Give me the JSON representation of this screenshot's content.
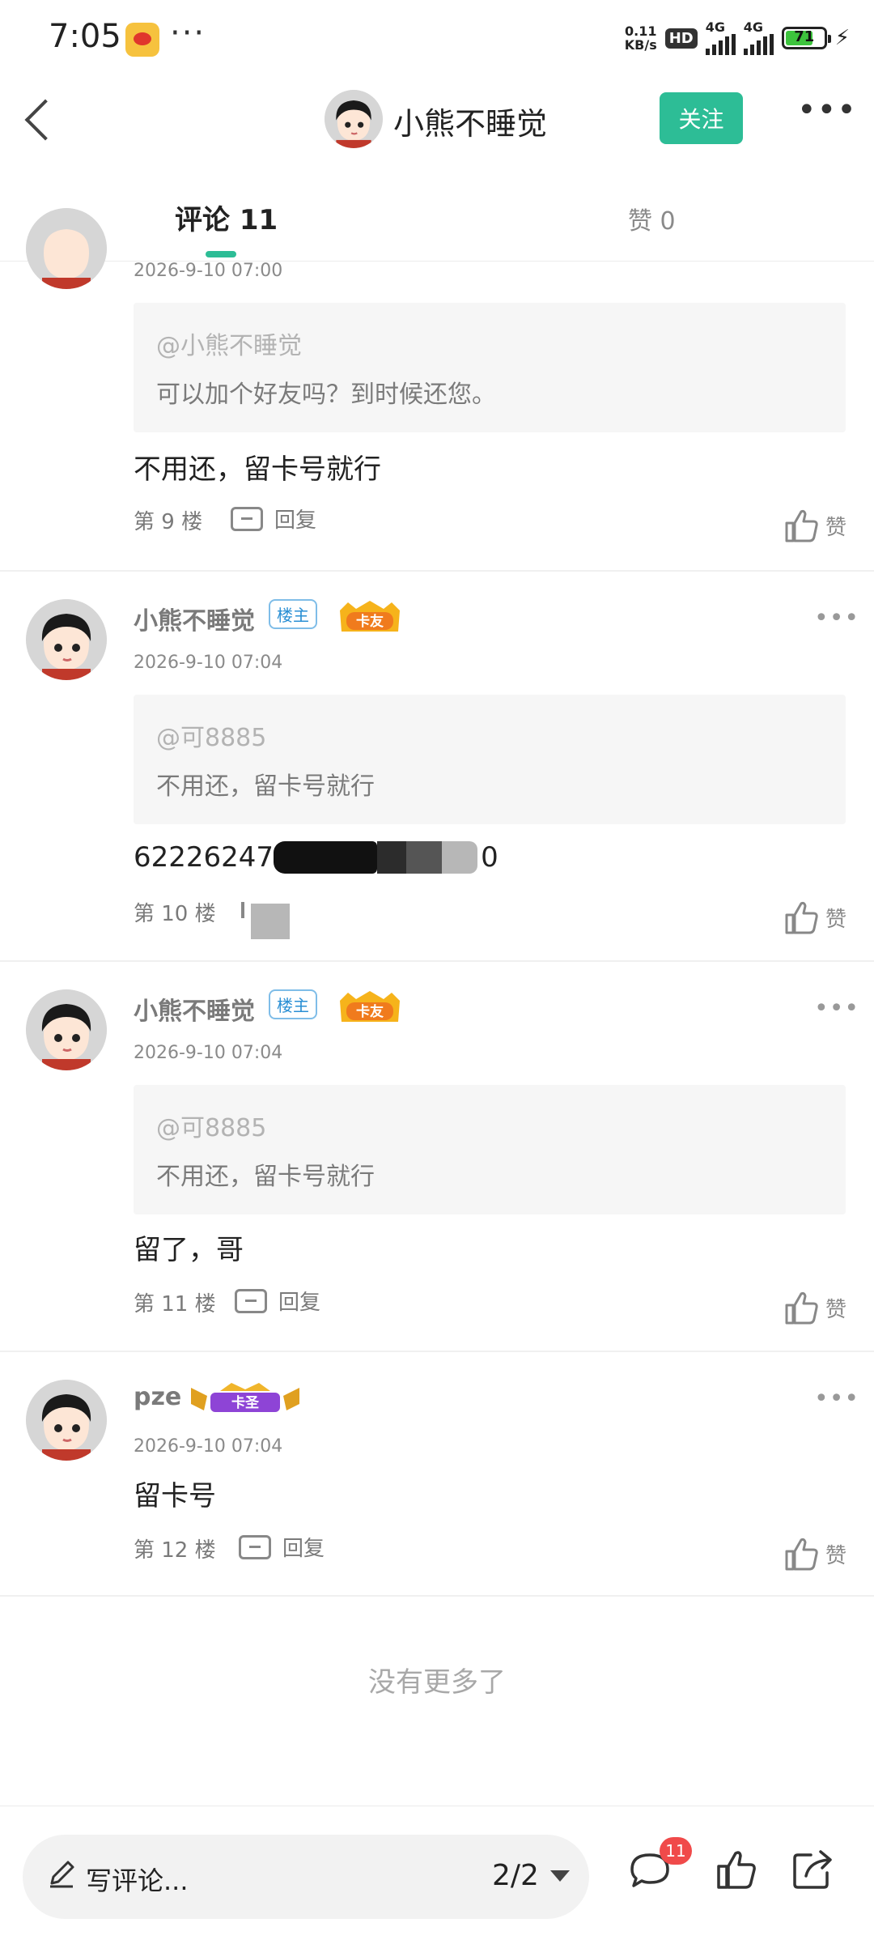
{
  "status_bar": {
    "time": "7:05",
    "app_icon": "weibo-icon",
    "more_dots": "···",
    "net_speed_top": "0.11",
    "net_speed_bottom": "KB/s",
    "hd_label": "HD",
    "signal1_label": "4G",
    "signal2_label": "4G",
    "battery_level": "71",
    "battery_fraction": 0.71
  },
  "header": {
    "username": "小熊不睡觉",
    "follow_label": "关注",
    "more_label": "•••"
  },
  "tabs": [
    {
      "label": "评论 11",
      "active": true
    },
    {
      "label": "赞 0",
      "active": false
    }
  ],
  "comments": [
    {
      "partial": true,
      "time": "2026-9-10 07:00",
      "quote_at": "@小熊不睡觉",
      "quote_text": "可以加个好友吗？到时候还您。",
      "text": "不用还，留卡号就行",
      "floor": "第 9 楼",
      "reply_label": "回复",
      "like_label": "赞"
    },
    {
      "name": "小熊不睡觉",
      "host_badge": "楼主",
      "level_badge": "卡友",
      "time": "2026-9-10 07:04",
      "quote_at": "@可8885",
      "quote_text": "不用还，留卡号就行",
      "text_start": "62226247",
      "text_end": "0",
      "floor": "第 10 楼",
      "like_label": "赞",
      "more": "•••"
    },
    {
      "name": "小熊不睡觉",
      "host_badge": "楼主",
      "level_badge": "卡友",
      "time": "2026-9-10 07:04",
      "quote_at": "@可8885",
      "quote_text": "不用还，留卡号就行",
      "text": "留了，哥",
      "floor": "第 11 楼",
      "reply_label": "回复",
      "like_label": "赞",
      "more": "•••"
    },
    {
      "name": "pze",
      "level_badge": "卡圣",
      "time": "2026-9-10 07:04",
      "text": "留卡号",
      "floor": "第 12 楼",
      "reply_label": "回复",
      "like_label": "赞",
      "more": "•••"
    }
  ],
  "footer": {
    "no_more": "没有更多了"
  },
  "bottom_bar": {
    "input_placeholder": "写评论...",
    "page_indicator": "2/2",
    "comment_count_badge": "11",
    "icons": [
      "pencil-icon",
      "comment-icon",
      "thumbs-up-icon",
      "share-icon"
    ]
  },
  "colors": {
    "accent": "#2dbd96",
    "badge_red": "#f04a4a",
    "host_badge_blue": "#2a8fd4"
  }
}
